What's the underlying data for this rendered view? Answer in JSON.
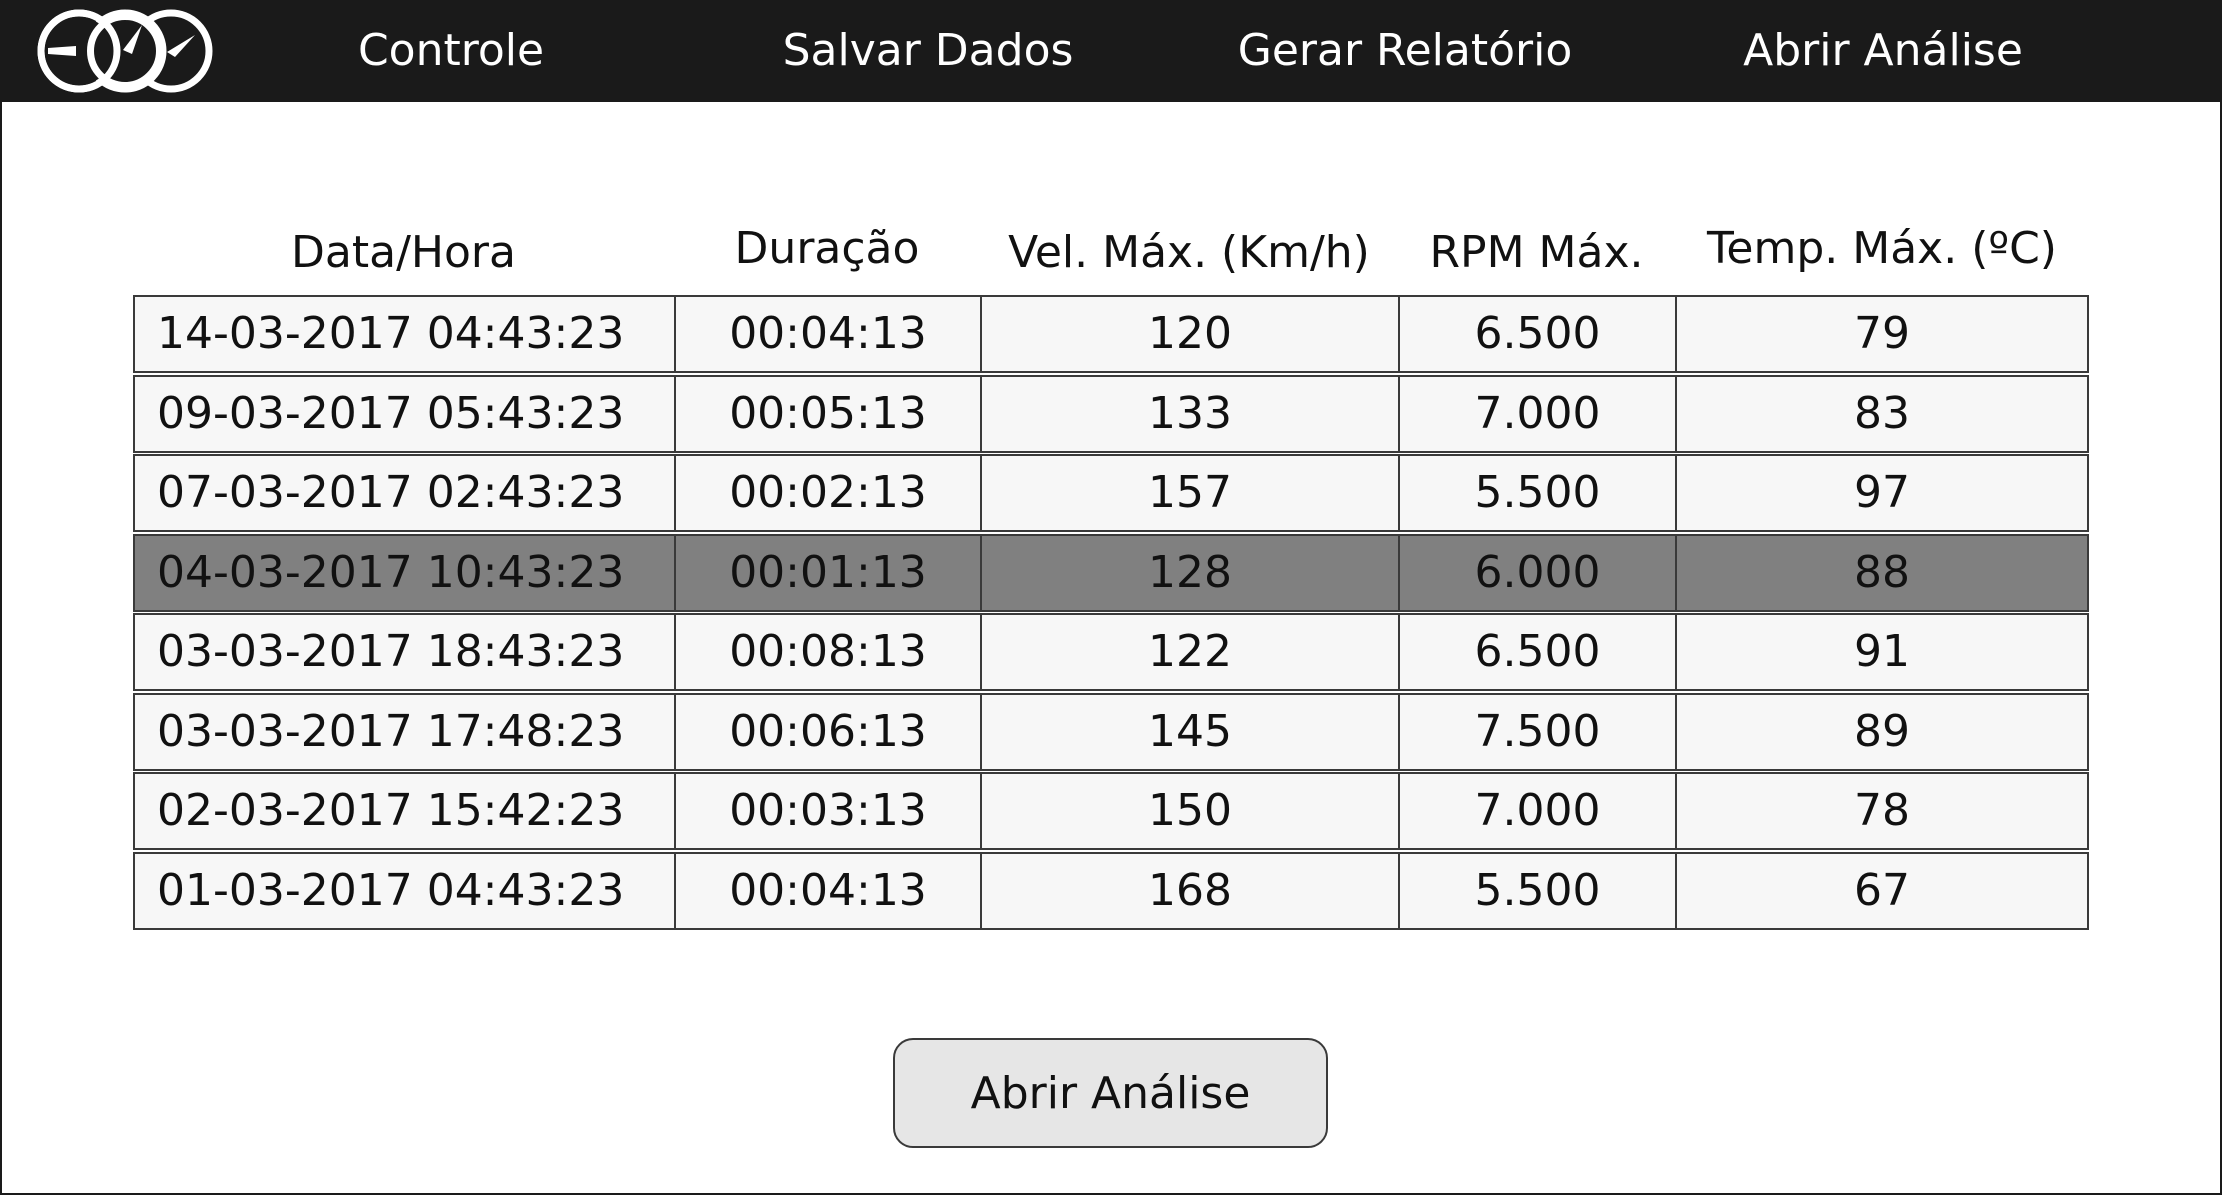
{
  "nav": {
    "items": [
      "Controle",
      "Salvar Dados",
      "Gerar Relatório",
      "Abrir Análise"
    ]
  },
  "icons": {
    "logo": "gauges-logo-icon"
  },
  "colors": {
    "topbar": "#1a1a1a",
    "selected_row": "#808080",
    "cell_bg": "#f7f7f7",
    "button_bg": "#e6e6e6"
  },
  "table": {
    "headers": [
      "Data/Hora",
      "Duração",
      "Vel. Máx. (Km/h)",
      "RPM Máx.",
      "Temp. Máx. (ºC)"
    ],
    "selected_index": 3,
    "rows": [
      [
        "14-03-2017 04:43:23",
        "00:04:13",
        "120",
        "6.500",
        "79"
      ],
      [
        "09-03-2017 05:43:23",
        "00:05:13",
        "133",
        "7.000",
        "83"
      ],
      [
        "07-03-2017 02:43:23",
        "00:02:13",
        "157",
        "5.500",
        "97"
      ],
      [
        "04-03-2017 10:43:23",
        "00:01:13",
        "128",
        "6.000",
        "88"
      ],
      [
        "03-03-2017 18:43:23",
        "00:08:13",
        "122",
        "6.500",
        "91"
      ],
      [
        "03-03-2017 17:48:23",
        "00:06:13",
        "145",
        "7.500",
        "89"
      ],
      [
        "02-03-2017 15:42:23",
        "00:03:13",
        "150",
        "7.000",
        "78"
      ],
      [
        "01-03-2017 04:43:23",
        "00:04:13",
        "168",
        "5.500",
        "67"
      ]
    ]
  },
  "action_button": {
    "label": "Abrir Análise"
  }
}
